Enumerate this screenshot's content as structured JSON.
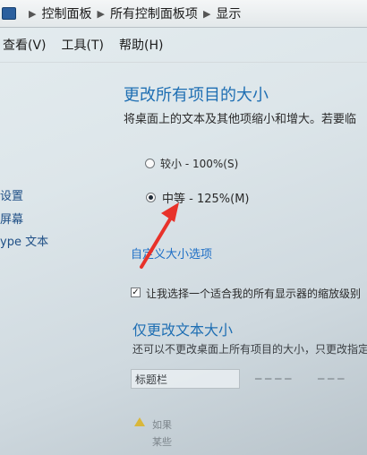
{
  "breadcrumb": {
    "items": [
      "控制面板",
      "所有控制面板项",
      "显示"
    ]
  },
  "menubar": {
    "items": [
      "查看(V)",
      "工具(T)",
      "帮助(H)"
    ]
  },
  "leftnav": {
    "items": [
      "设置",
      "屏幕",
      "ype 文本"
    ]
  },
  "main": {
    "title": "更改所有项目的大小",
    "description": "将桌面上的文本及其他项缩小和增大。若要临",
    "options": [
      {
        "label": "较小 - 100%(S)",
        "checked": false
      },
      {
        "label": "中等 - 125%(M)",
        "checked": true
      }
    ],
    "custom_link": "自定义大小选项",
    "checkbox": {
      "label": "让我选择一个适合我的所有显示器的缩放级别",
      "checked": true
    },
    "subtitle": "仅更改文本大小",
    "subdescription": "还可以不更改桌面上所有项目的大小，只更改指定",
    "dropdown_value": "标题栏",
    "warning_lines": [
      "如果",
      "某些"
    ]
  },
  "colors": {
    "link": "#1e6fc6",
    "heading": "#1f6fb3",
    "arrow": "#e8322a"
  }
}
